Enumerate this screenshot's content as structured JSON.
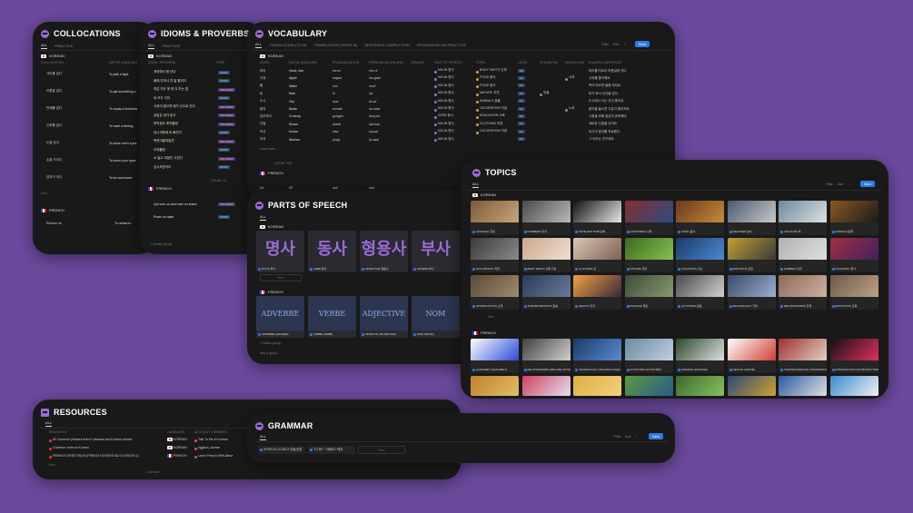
{
  "collocations": {
    "title": "COLLOCATIONS",
    "tabs": [
      "ALL",
      "PRACTICE"
    ],
    "group_kr": "KOREAN",
    "group_fr": "FRENCH",
    "columns": [
      "COLLOCATION",
      "NATIVE (ENGLISH)"
    ],
    "rows": [
      {
        "kr": "사비를 걸다",
        "en": "To pick a fight"
      },
      {
        "kr": "이름을 걸다",
        "en": "To get something o"
      },
      {
        "kr": "판례를 걸다",
        "en": "To repay a kindness"
      },
      {
        "kr": "신뢰를 걸다",
        "en": "To have a feeling"
      },
      {
        "kr": "눈을 감다",
        "en": "To close one's eyes"
      },
      {
        "kr": "손을 거리다",
        "en": "To cover your eyes"
      },
      {
        "kr": "답처가 아다",
        "en": "To be convinced"
      }
    ],
    "new_label": "New",
    "fr_rows": [
      {
        "fr": "Refuser de",
        "en": "To refuse to"
      }
    ]
  },
  "idioms": {
    "title": "IDIOMS & PROVERBS",
    "tabs": [
      "ALL",
      "PRACTICE"
    ],
    "group_kr": "KOREAN",
    "group_fr": "FRENCH",
    "columns": [
      "IDIOM / PROVERB",
      "TYPE"
    ],
    "rows": [
      {
        "text": "개천에서 용 난다",
        "type": "IDIOM"
      },
      {
        "text": "배에 주머니 찬 달 팔리다",
        "type": "IDIOM"
      },
      {
        "text": "작은 거도 못 한 자 차는 법",
        "type": "PROVERB"
      },
      {
        "text": "내 코가 석자",
        "type": "IDIOM"
      },
      {
        "text": "사공이 많으면 배가 산으로 간다",
        "type": "PROVERB"
      },
      {
        "text": "낮말은 새가 듣고",
        "type": "PROVERB"
      },
      {
        "text": "편의점도 못먹을때",
        "type": "PROVERB"
      },
      {
        "text": "당나귀에게 비 빠진다",
        "type": "IDIOM"
      },
      {
        "text": "백견이불여일견",
        "type": "PROVERB"
      },
      {
        "text": "오매불망",
        "type": "IDIOM"
      },
      {
        "text": "소 잃고 외양간 고친다",
        "type": "PROVERB"
      },
      {
        "text": "금시초문이다",
        "type": "IDIOM"
      }
    ],
    "fr_rows": [
      {
        "text": "Qui vole un oeuf vole un boeuf",
        "type": "PROVERB"
      },
      {
        "text": "Poser un lapin",
        "type": "IDIOM"
      }
    ],
    "count_label": "COUNT 12",
    "group_hidden": "1 hidden group"
  },
  "vocabulary": {
    "title": "VOCABULARY",
    "tabs": [
      "ALL",
      "TRANSLATION (TO M)",
      "TRANSLATION (FROM M)",
      "SENTENCE COMPLETION",
      "PRONUNCIATION PRACTICE"
    ],
    "toolbar": [
      "Filter",
      "Sort"
    ],
    "new_label": "New",
    "group_kr": "KOREAN",
    "group_fr": "FRENCH",
    "columns": [
      "WORD",
      "NATIVE (ENGLISH)",
      "PRONUNCIATION",
      "PRONUNCIATION (IPA)",
      "GENDER",
      "PART OF SPEECH",
      "TOPIC",
      "LEVEL",
      "SYNONYMS",
      "HOMONYMS",
      "EXAMPLE SENTENCE"
    ],
    "rows": [
      {
        "word": "머리",
        "en": "Head, hair",
        "pron": "meori",
        "ipa": "/mʌ.ɾi/",
        "pos": "NOUN 명사",
        "topic": "BODY PARTS 신체",
        "lvl": "A2",
        "syn": "",
        "hom": "",
        "ex": "머리를 자르러 미용실에 갔다"
      },
      {
        "word": "사과",
        "en": "Apple",
        "pron": "sagwa",
        "ipa": "/sa.gwa/",
        "pos": "NOUN 명사",
        "topic": "FOOD 음식",
        "lvl": "A1",
        "syn": "",
        "hom": "사과",
        "ex": "사과를 좋아해요."
      },
      {
        "word": "물",
        "en": "Water",
        "pron": "mul",
        "ipa": "/mul/",
        "pos": "NOUN 명사",
        "topic": "FOOD 음식",
        "lvl": "A1",
        "syn": "",
        "hom": "",
        "ex": "목이 마르면 물을 마셔요."
      },
      {
        "word": "비",
        "en": "Rain",
        "pron": "bi",
        "ipa": "/pi/",
        "pos": "NOUN 명사",
        "topic": "NATURE 자연",
        "lvl": "A1",
        "syn": "빗물",
        "hom": "",
        "ex": "비가 와서 우산을 샀다."
      },
      {
        "word": "도시",
        "en": "City",
        "pron": "dosi",
        "ipa": "/to.ɕi/",
        "pos": "NOUN 명사",
        "topic": "ANIMALS 동물",
        "lvl": "A1",
        "syn": "",
        "hom": "",
        "ex": "도시에서 사는 것이 좋아요."
      },
      {
        "word": "음악",
        "en": "Music",
        "pron": "eumak",
        "ipa": "/ɯ.mak/",
        "pos": "NOUN 명사",
        "topic": "OCCUPATION 직업",
        "lvl": "A1",
        "syn": "",
        "hom": "노래",
        "ex": "음악을 들으면 기분이 좋아져요."
      },
      {
        "word": "공부하다",
        "en": "To study",
        "pron": "gongbu",
        "ipa": "/koŋ.bu/",
        "pos": "VERB 동사",
        "topic": "EDUCATION 교육",
        "lvl": "A1",
        "syn": "",
        "hom": "",
        "ex": "시험을 위해 열심히 공부해야"
      },
      {
        "word": "신발",
        "en": "Shoes",
        "pron": "sinbal",
        "ipa": "/ɕin.bal/",
        "pos": "NOUN 명사",
        "topic": "CLOTHING 의류",
        "lvl": "A1",
        "syn": "",
        "hom": "",
        "ex": "새로운 신발을 샀어요."
      },
      {
        "word": "의사",
        "en": "Doctor",
        "pron": "uisa",
        "ipa": "/ɰi.sa/",
        "pos": "NOUN 명사",
        "topic": "OCCUPATION 직업",
        "lvl": "A1",
        "syn": "",
        "hom": "",
        "ex": "의사가 환자를 치료했다."
      },
      {
        "word": "여자",
        "en": "Woman",
        "pron": "yeoja",
        "ipa": "/jʌ.dʑa/",
        "pos": "NOUN 명사",
        "topic": "",
        "lvl": "A1",
        "syn": "",
        "hom": "",
        "ex": "그 여자는 친구예요."
      }
    ],
    "fr_rows": [
      {
        "word": "De",
        "en": "Of",
        "pron": "duh",
        "ipa": "/də/"
      }
    ],
    "load_more": "Load more",
    "count_label": "COUNT 200"
  },
  "parts_of_speech": {
    "title": "PARTS OF SPEECH",
    "tabs": [
      "ALL"
    ],
    "group_kr": "KOREAN",
    "group_fr": "FRENCH",
    "kr_cards": [
      {
        "big": "명사",
        "cap": "NOUN 명사"
      },
      {
        "big": "동사",
        "cap": "VERB 동사"
      },
      {
        "big": "형용사",
        "cap": "ADJECTIVE 형용사"
      },
      {
        "big": "부사",
        "cap": "ADVERB 부사"
      }
    ],
    "fr_cards": [
      {
        "big": "ADVERBE",
        "cap": "ADVERBE (ADVERB)"
      },
      {
        "big": "VERBE",
        "cap": "VERBE (VERB)"
      },
      {
        "big": "ADJECTIVE",
        "cap": "ADJECTIF (ADJECTIVE)"
      },
      {
        "big": "NOM",
        "cap": "NOM (NOUN)"
      }
    ],
    "new_label": "New",
    "hidden": "1 hidden group",
    "add_group": "Add a group"
  },
  "topics": {
    "title": "TOPICS",
    "tabs": [
      "ALL"
    ],
    "toolbar": [
      "Filter",
      "Sort"
    ],
    "new_label": "New",
    "group_kr": "KOREAN",
    "group_fr": "FRENCH",
    "kr_cards": [
      {
        "cap": "HANGEUL 한글",
        "c1": "#7a5a3a",
        "c2": "#c9a77a"
      },
      {
        "cap": "NUMBERS 숫자",
        "c1": "#4b4b4b",
        "c2": "#b9b9b9"
      },
      {
        "cap": "DATE AND TIME 날짜",
        "c1": "#111111",
        "c2": "#e6e6e6"
      },
      {
        "cap": "COUNTRIES 나라",
        "c1": "#803030",
        "c2": "#304a80"
      },
      {
        "cap": "FOOD 음식",
        "c1": "#6a3a1a",
        "c2": "#c78a3a"
      },
      {
        "cap": "WEATHER 날씨",
        "c1": "#4a5a70",
        "c2": "#c9c9c9"
      },
      {
        "cap": "COLOURS 색",
        "c1": "#6a8aa0",
        "c2": "#e0e0e0"
      },
      {
        "cap": "ANIMALS 동물",
        "c1": "#8a5a20",
        "c2": "#1a1a1a"
      },
      {
        "cap": "OCCUPATION 직업",
        "c1": "#3a3a3a",
        "c2": "#8a8a8a"
      },
      {
        "cap": "BODY PARTS 신체 기관",
        "c1": "#c9a890",
        "c2": "#f0e0d0"
      },
      {
        "cap": "CLOTHING 옷",
        "c1": "#d8c8b8",
        "c2": "#806050"
      },
      {
        "cap": "NATURE 자연",
        "c1": "#3a6a20",
        "c2": "#8ac050"
      },
      {
        "cap": "LOCATIONS 장소",
        "c1": "#1a3a6a",
        "c2": "#4a8ad0"
      },
      {
        "cap": "EMOTIONS 감정",
        "c1": "#c0a030",
        "c2": "#3a3a3a"
      },
      {
        "cap": "HOBBIES 취미",
        "c1": "#b0b0b0",
        "c2": "#e0e0e0"
      },
      {
        "cap": "OCCASION 행사",
        "c1": "#a03040",
        "c2": "#402060"
      },
      {
        "cap": "INTRODUCTION 소개",
        "c1": "#5a4a3a",
        "c2": "#a08a6a"
      },
      {
        "cap": "TRANSPORTATION 운송",
        "c1": "#2a3a5a",
        "c2": "#6a7a9a"
      },
      {
        "cap": "HEALTH 건강",
        "c1": "#f0a040",
        "c2": "#3a2a3a"
      },
      {
        "cap": "FINANCE 재정",
        "c1": "#3a4a3a",
        "c2": "#8a9a6a"
      },
      {
        "cap": "ACTIVITIES 활동",
        "c1": "#4a4a4a",
        "c2": "#d0d0d0"
      },
      {
        "cap": "TECHNOLOGY 기술",
        "c1": "#3a4a6a",
        "c2": "#9ab0d0"
      },
      {
        "cap": "RELATIONSHIPS 관계",
        "c1": "#8a6a5a",
        "c2": "#d0b0a0"
      },
      {
        "cap": "EDUCATION 교육",
        "c1": "#6a5a4a",
        "c2": "#c0a080"
      }
    ],
    "fr_cards": [
      {
        "cap": "ALPHABET (ALPHABET)",
        "c1": "#ffffff",
        "c2": "#2a4bd7"
      },
      {
        "cap": "RELATIONSHIPS (DES RELATIONS)",
        "c1": "#404040",
        "c2": "#d0d0d0"
      },
      {
        "cap": "TECHNOLOGY (TECHNOLOGIE)",
        "c1": "#1a3a6a",
        "c2": "#5a8ad0"
      },
      {
        "cap": "ACTIVITIES (ACTIVITÉS)",
        "c1": "#6a8aa0",
        "c2": "#c0d0e0"
      },
      {
        "cap": "FINANCE (FINANCE)",
        "c1": "#2a4a2a",
        "c2": "#e0e0e0"
      },
      {
        "cap": "HEALTH (SANTÉ)",
        "c1": "#ffffff",
        "c2": "#d04030"
      },
      {
        "cap": "TRANSPORTATION (TRANSPORT)",
        "c1": "#a03030",
        "c2": "#e0d0c0"
      },
      {
        "cap": "INTRODUCTION (INTRODUCTION)",
        "c1": "#111111",
        "c2": "#e03060"
      },
      {
        "cap": "",
        "c1": "#c08030",
        "c2": "#e0c060"
      },
      {
        "cap": "",
        "c1": "#d04060",
        "c2": "#e0e0f0"
      },
      {
        "cap": "",
        "c1": "#e0b040",
        "c2": "#f0d080"
      },
      {
        "cap": "",
        "c1": "#5a9a40",
        "c2": "#2a5a8a"
      },
      {
        "cap": "",
        "c1": "#3a6a30",
        "c2": "#8ac060"
      },
      {
        "cap": "",
        "c1": "#2a4a7a",
        "c2": "#d0a030"
      },
      {
        "cap": "",
        "c1": "#2a5aa0",
        "c2": "#e0e0e0"
      },
      {
        "cap": "",
        "c1": "#3a8ad0",
        "c2": "#f0f0f0"
      }
    ],
    "new_row": "New"
  },
  "resources": {
    "title": "RESOURCES",
    "tabs": [
      "ALL"
    ],
    "columns": [
      "RESOURCE",
      "LANGUAGE",
      "ACCOUNT / WEBSITE"
    ],
    "rows": [
      {
        "res": "50 Common phrases from K-dramas and Korean movies",
        "lang": "KOREAN",
        "acct": "Talk To Me In Korean"
      },
      {
        "res": "Common verbs in Korean",
        "lang": "KOREAN",
        "acct": "eggbun_korean"
      },
      {
        "res": "FRENCH GREETINGS (FRENCH ESSENTIALS LESSON 1)",
        "lang": "FRENCH",
        "acct": "Learn French With Alexa"
      }
    ],
    "new_label": "New",
    "count_label": "Calculate"
  },
  "grammar": {
    "title": "GRAMMAR",
    "tabs": [
      "ALL"
    ],
    "toolbar": [
      "Filter",
      "Sort"
    ],
    "new_label": "New",
    "cards": [
      "SPEECH LEVELS 말높임법",
      "TO BE ~이에요/~예요"
    ],
    "new_card": "New"
  }
}
